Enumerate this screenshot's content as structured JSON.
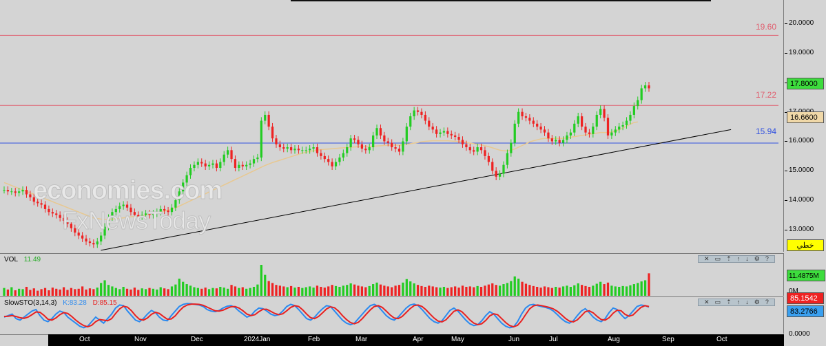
{
  "chart_data": {
    "type": "candlestick",
    "x_labels": [
      "Oct",
      "Nov",
      "Dec",
      "2024Jan",
      "Feb",
      "Mar",
      "Apr",
      "May",
      "Jun",
      "Jul",
      "Aug",
      "Sep",
      "Oct"
    ],
    "ylim": [
      12.25,
      20.8
    ],
    "y_ticks": [
      "20.0000",
      "19.0000",
      "18.0000",
      "17.0000",
      "16.0000",
      "15.0000",
      "14.0000",
      "13.0000"
    ],
    "closes": [
      14.35,
      14.3,
      14.3,
      14.25,
      14.3,
      14.35,
      14.2,
      14.1,
      13.95,
      13.9,
      13.85,
      13.7,
      13.6,
      13.55,
      13.5,
      13.4,
      13.3,
      13.2,
      13.05,
      12.9,
      12.8,
      12.7,
      12.6,
      12.55,
      12.5,
      12.6,
      12.8,
      13.1,
      13.4,
      13.6,
      13.7,
      13.8,
      13.85,
      13.75,
      13.6,
      13.5,
      13.45,
      13.5,
      13.55,
      13.5,
      13.55,
      13.6,
      13.7,
      13.65,
      13.6,
      13.75,
      14.0,
      14.3,
      14.6,
      14.85,
      15.1,
      15.2,
      15.3,
      15.25,
      15.15,
      15.2,
      15.25,
      15.1,
      15.3,
      15.55,
      15.7,
      15.4,
      15.1,
      15.2,
      15.15,
      15.2,
      15.25,
      15.4,
      15.45,
      16.7,
      16.9,
      16.5,
      16.1,
      15.9,
      15.8,
      15.75,
      15.8,
      15.7,
      15.75,
      15.7,
      15.7,
      15.7,
      15.75,
      15.8,
      15.6,
      15.5,
      15.4,
      15.3,
      15.15,
      15.3,
      15.45,
      15.6,
      15.8,
      16.1,
      16.05,
      15.9,
      15.75,
      15.7,
      15.8,
      16.2,
      16.45,
      16.2,
      16.0,
      15.95,
      15.8,
      15.75,
      15.65,
      16.0,
      16.5,
      16.85,
      17.05,
      17.0,
      16.9,
      16.7,
      16.5,
      16.4,
      16.25,
      16.3,
      16.35,
      16.25,
      16.2,
      16.15,
      16.05,
      15.9,
      15.8,
      15.7,
      15.65,
      15.8,
      15.7,
      15.5,
      15.3,
      15.0,
      14.8,
      14.9,
      15.2,
      15.6,
      15.95,
      16.6,
      17.0,
      16.85,
      16.8,
      16.7,
      16.6,
      16.5,
      16.4,
      16.3,
      16.1,
      16.0,
      16.05,
      15.95,
      16.05,
      16.2,
      16.3,
      16.6,
      16.85,
      16.5,
      16.3,
      16.25,
      16.5,
      16.9,
      17.1,
      16.8,
      16.2,
      16.3,
      16.4,
      16.5,
      16.55,
      16.7,
      16.9,
      17.2,
      17.4,
      17.8,
      17.9,
      17.8
    ],
    "volumes": [
      2.2,
      1.8,
      2.4,
      1.6,
      2.0,
      1.9,
      2.5,
      1.7,
      2.1,
      1.5,
      1.9,
      2.2,
      1.6,
      2.3,
      2.0,
      1.8,
      2.4,
      1.7,
      2.2,
      1.9,
      2.0,
      2.6,
      1.8,
      2.1,
      1.9,
      2.3,
      3.5,
      4.2,
      3.0,
      2.6,
      2.2,
      1.9,
      2.5,
      2.0,
      1.8,
      2.3,
      1.7,
      2.1,
      1.9,
      2.2,
      2.0,
      1.8,
      2.4,
      2.1,
      1.9,
      2.6,
      3.1,
      4.6,
      3.8,
      3.2,
      2.8,
      2.4,
      2.2,
      2.0,
      2.3,
      1.9,
      2.2,
      2.1,
      2.5,
      2.3,
      2.0,
      3.0,
      2.6,
      2.2,
      2.4,
      2.0,
      2.2,
      2.5,
      3.1,
      8.2,
      5.6,
      4.0,
      3.5,
      3.0,
      2.8,
      2.6,
      2.4,
      2.7,
      2.3,
      2.5,
      2.2,
      2.4,
      2.6,
      2.3,
      2.8,
      2.5,
      2.3,
      2.6,
      3.0,
      2.7,
      2.5,
      2.8,
      3.0,
      3.4,
      3.1,
      2.8,
      2.6,
      2.4,
      2.7,
      3.2,
      3.6,
      3.1,
      2.8,
      2.6,
      2.4,
      2.8,
      3.0,
      3.6,
      4.5,
      3.9,
      3.4,
      3.0,
      2.7,
      2.5,
      2.8,
      2.6,
      2.4,
      2.3,
      2.5,
      2.2,
      2.4,
      2.6,
      2.3,
      2.8,
      2.5,
      2.6,
      2.4,
      2.7,
      2.5,
      2.8,
      3.1,
      3.4,
      3.0,
      2.8,
      3.2,
      3.5,
      4.0,
      5.2,
      4.6,
      3.8,
      3.3,
      3.0,
      2.7,
      2.5,
      2.3,
      2.6,
      2.4,
      2.2,
      2.5,
      2.3,
      2.6,
      2.8,
      2.5,
      2.9,
      3.4,
      3.0,
      2.7,
      2.5,
      2.8,
      3.3,
      3.8,
      3.2,
      3.6,
      2.8,
      2.6,
      2.5,
      2.7,
      2.6,
      2.9,
      3.2,
      3.5,
      3.9,
      4.2,
      6.0
    ],
    "sto_k": [
      50,
      55,
      60,
      45,
      40,
      50,
      60,
      70,
      75,
      55,
      40,
      35,
      45,
      60,
      70,
      65,
      50,
      40,
      30,
      20,
      15,
      20,
      35,
      50,
      40,
      30,
      45,
      60,
      80,
      90,
      88,
      70,
      55,
      40,
      35,
      45,
      60,
      72,
      65,
      50,
      40,
      38,
      55,
      70,
      85,
      92,
      95,
      94,
      92,
      90,
      85,
      75,
      70,
      68,
      72,
      80,
      86,
      88,
      82,
      70,
      60,
      50,
      55,
      70,
      80,
      78,
      70,
      60,
      55,
      58,
      70,
      85,
      92,
      88,
      75,
      60,
      45,
      40,
      50,
      65,
      78,
      88,
      85,
      70,
      55,
      40,
      30,
      25,
      30,
      45,
      60,
      75,
      88,
      92,
      85,
      70,
      55,
      45,
      40,
      50,
      65,
      80,
      90,
      93,
      88,
      75,
      60,
      45,
      35,
      30,
      38,
      55,
      72,
      80,
      70,
      55,
      40,
      28,
      22,
      25,
      38,
      55,
      68,
      60,
      45,
      30,
      20,
      15,
      18,
      35,
      60,
      80,
      90,
      92,
      88,
      85,
      82,
      78,
      70,
      58,
      45,
      35,
      30,
      38,
      55,
      70,
      78,
      65,
      50,
      40,
      35,
      45,
      65,
      80,
      75,
      58,
      45,
      55,
      70,
      85,
      90,
      88,
      83
    ],
    "sto_d": [
      52,
      53,
      55,
      52,
      48,
      46,
      50,
      58,
      67,
      66,
      56,
      43,
      40,
      47,
      58,
      65,
      62,
      52,
      40,
      30,
      22,
      18,
      23,
      35,
      42,
      40,
      38,
      45,
      62,
      77,
      86,
      83,
      71,
      55,
      43,
      40,
      47,
      59,
      66,
      62,
      52,
      43,
      44,
      54,
      70,
      83,
      90,
      93,
      93,
      92,
      89,
      83,
      77,
      71,
      70,
      73,
      79,
      84,
      85,
      80,
      71,
      60,
      55,
      58,
      68,
      76,
      76,
      69,
      62,
      58,
      61,
      71,
      82,
      88,
      85,
      74,
      60,
      48,
      45,
      52,
      64,
      77,
      84,
      81,
      70,
      55,
      42,
      32,
      28,
      33,
      45,
      60,
      74,
      85,
      88,
      82,
      70,
      57,
      47,
      45,
      52,
      65,
      78,
      88,
      90,
      85,
      74,
      60,
      47,
      37,
      34,
      41,
      55,
      69,
      74,
      68,
      55,
      41,
      30,
      25,
      28,
      39,
      54,
      61,
      58,
      45,
      32,
      22,
      18,
      23,
      38,
      58,
      77,
      87,
      90,
      88,
      85,
      82,
      77,
      69,
      58,
      46,
      37,
      34,
      41,
      54,
      68,
      71,
      64,
      52,
      42,
      40,
      48,
      63,
      73,
      71,
      59,
      53,
      57,
      70,
      82,
      88,
      85
    ],
    "ma": [
      14.6,
      14.55,
      14.5,
      14.45,
      14.4,
      14.35,
      14.3,
      14.25,
      14.2,
      14.15,
      14.1,
      14.05,
      14.0,
      13.95,
      13.9,
      13.85,
      13.8,
      13.75,
      13.7,
      13.65,
      13.6,
      13.55,
      13.5,
      13.45,
      13.4,
      13.38,
      13.36,
      13.35,
      13.35,
      13.36,
      13.37,
      13.39,
      13.4,
      13.42,
      13.44,
      13.45,
      13.46,
      13.48,
      13.5,
      13.52,
      13.55,
      13.58,
      13.6,
      13.63,
      13.66,
      13.7,
      13.74,
      13.8,
      13.86,
      13.92,
      13.98,
      14.04,
      14.1,
      14.16,
      14.22,
      14.28,
      14.34,
      14.4,
      14.46,
      14.52,
      14.58,
      14.64,
      14.7,
      14.76,
      14.82,
      14.88,
      14.94,
      15.0,
      15.06,
      15.12,
      15.18,
      15.23,
      15.28,
      15.32,
      15.36,
      15.4,
      15.44,
      15.48,
      15.52,
      15.56,
      15.6,
      15.63,
      15.66,
      15.68,
      15.7,
      15.72,
      15.73,
      15.74,
      15.75,
      15.76,
      15.77,
      15.78,
      15.79,
      15.8,
      15.81,
      15.82,
      15.82,
      15.82,
      15.82,
      15.83,
      15.84,
      15.85,
      15.86,
      15.87,
      15.87,
      15.87,
      15.87,
      15.88,
      15.9,
      15.92,
      15.94,
      15.96,
      15.98,
      16.0,
      16.01,
      16.02,
      16.02,
      16.02,
      16.02,
      16.02,
      16.01,
      16.0,
      15.99,
      15.98,
      15.96,
      15.94,
      15.92,
      15.9,
      15.88,
      15.85,
      15.82,
      15.78,
      15.74,
      15.7,
      15.68,
      15.68,
      15.7,
      15.74,
      15.8,
      15.86,
      15.92,
      15.98,
      16.02,
      16.05,
      16.08,
      16.1,
      16.1,
      16.1,
      16.1,
      16.1,
      16.1,
      16.12,
      16.14,
      16.16,
      16.18,
      16.2,
      16.22,
      16.24,
      16.26,
      16.28,
      16.3,
      16.3,
      16.3,
      16.32,
      16.35,
      16.4,
      16.45,
      16.52,
      16.58,
      16.64,
      16.66
    ],
    "horizontal_lines": [
      {
        "value": 19.6,
        "label": "19.60",
        "color": "#e06070"
      },
      {
        "value": 17.22,
        "label": "17.22",
        "color": "#e06070"
      },
      {
        "value": 15.94,
        "label": "15.94",
        "color": "#3050e0"
      }
    ],
    "trendline": {
      "from": [
        0.15,
        12.3
      ],
      "to": [
        0.967,
        16.4
      ],
      "color": "#000000"
    },
    "volume_ticks": [
      "11.4875M",
      "0M"
    ],
    "sto_ticks": [
      "85.1542",
      "83.2766",
      "0.0000"
    ]
  },
  "volume": {
    "label": "VOL",
    "value": "11.49"
  },
  "stochastic": {
    "label": "SlowSTO(3,14,3)",
    "k_label": "K:83.28",
    "d_label": "D:85.15"
  },
  "tags": {
    "last_price": "17.8000",
    "ma_value": "16.6600",
    "line_type": "خطي",
    "vol_last": "11.4875M",
    "sto_d": "85.1542",
    "sto_k": "83.2766"
  },
  "colors": {
    "up": "#22cc22",
    "down": "#ee2222",
    "ma": "#e8c890",
    "sto_k": "#2a8af0",
    "sto_d": "#e82020",
    "tag_green": "#3ddc3d",
    "tag_ma": "#f0d8a8",
    "tag_yellow": "#ffff00",
    "tag_red": "#ee2222",
    "tag_blue": "#3aa0f0"
  },
  "watermark": {
    "line1": "economies.com",
    "line2": "FxNewsToday"
  },
  "toolbar_icons": [
    "close-icon",
    "maximize-icon",
    "move-up-icon",
    "arrow-up-icon",
    "arrow-down-icon",
    "settings-icon",
    "help-icon"
  ]
}
